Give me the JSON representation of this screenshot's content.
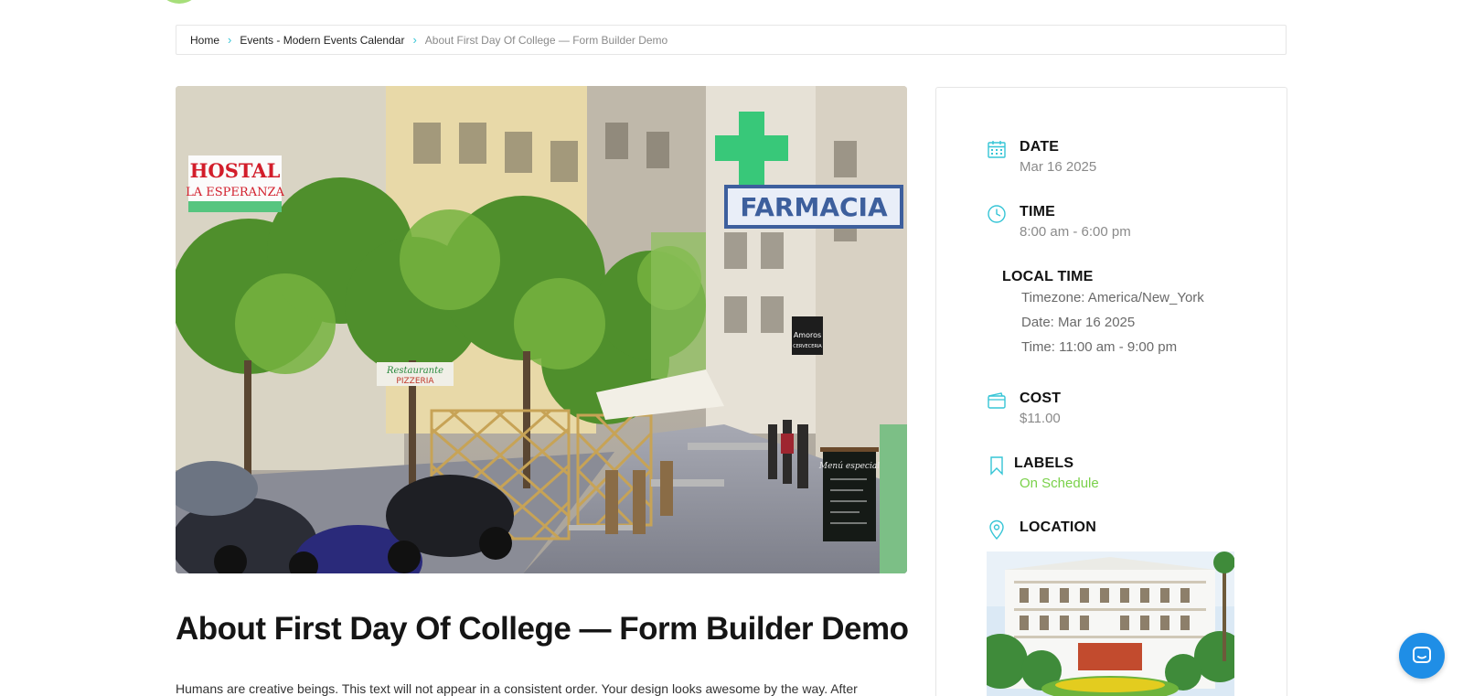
{
  "breadcrumb": {
    "home": "Home",
    "category": "Events - Modern Events Calendar",
    "current": "About First Day Of College — Form Builder Demo",
    "separator": "›"
  },
  "event": {
    "image_alt": "Street with Farmacia and Hostal La Esperanza signs",
    "title": "About First Day Of College — Form Builder Demo",
    "description_start": "Humans are creative beings. This text will not appear in a consistent order. Your design looks awesome by the way. After"
  },
  "sidebar": {
    "date": {
      "label": "DATE",
      "value": "Mar 16 2025",
      "icon": "calendar-icon"
    },
    "time": {
      "label": "TIME",
      "value": "8:00 am - 6:00 pm",
      "icon": "clock-icon"
    },
    "local_time": {
      "label": "LOCAL TIME",
      "timezone": "Timezone: America/New_York",
      "date": "Date: Mar 16 2025",
      "time": "Time: 11:00 am - 9:00 pm"
    },
    "cost": {
      "label": "COST",
      "value": "$11.00",
      "icon": "wallet-icon"
    },
    "labels": {
      "label": "LABELS",
      "value": "On Schedule",
      "icon": "bookmark-icon"
    },
    "location": {
      "label": "LOCATION",
      "icon": "map-pin-icon"
    }
  },
  "hero_signs": {
    "hostal": "HOSTAL",
    "hostal_sub": "LA ESPERANZA",
    "farmacia": "FARMACIA",
    "restaurante": "Restaurante",
    "pizzeria": "PIZZERIA",
    "amoros": "Amoros",
    "cerveceria": "CERVECERIA",
    "menu": "Menú especial"
  },
  "colors": {
    "accent": "#36c5d6",
    "label_green": "#7ad14a",
    "chat_blue": "#1f8ee6"
  }
}
